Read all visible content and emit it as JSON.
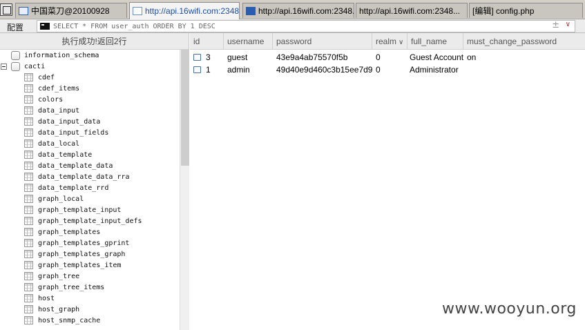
{
  "tabs": [
    {
      "label": "中国菜刀@20100928",
      "icon": "window-icon"
    },
    {
      "label": "http://api.16wifi.com:2348...",
      "icon": "page-icon",
      "active": true
    },
    {
      "label": "http://api.16wifi.com:2348...",
      "icon": "terminal-icon"
    },
    {
      "label": "http://api.16wifi.com:2348...",
      "icon": "folder-icon"
    },
    {
      "label": "[编辑] config.php",
      "icon": "edit-icon"
    }
  ],
  "query": {
    "config_label": "配置",
    "sql": "SELECT * FROM user_auth ORDER BY 1 DESC",
    "plus": "±",
    "dropdown": "∨"
  },
  "status": "执行成功!返回2行",
  "tree": {
    "databases": [
      {
        "name": "information_schema"
      },
      {
        "name": "cacti"
      }
    ],
    "tables": [
      "cdef",
      "cdef_items",
      "colors",
      "data_input",
      "data_input_data",
      "data_input_fields",
      "data_local",
      "data_template",
      "data_template_data",
      "data_template_data_rra",
      "data_template_rrd",
      "graph_local",
      "graph_template_input",
      "graph_template_input_defs",
      "graph_templates",
      "graph_templates_gprint",
      "graph_templates_graph",
      "graph_templates_item",
      "graph_tree",
      "graph_tree_items",
      "host",
      "host_graph",
      "host_snmp_cache"
    ]
  },
  "grid": {
    "columns": [
      "id",
      "username",
      "password",
      "realm",
      "full_name",
      "must_change_password"
    ],
    "rows": [
      {
        "id": "3",
        "username": "guest",
        "password": "43e9a4ab75570f5b",
        "realm": "0",
        "full_name": "Guest Account",
        "must_change_password": "on"
      },
      {
        "id": "1",
        "username": "admin",
        "password": "49d40e9d460c3b15ee7d9...",
        "realm": "0",
        "full_name": "Administrator",
        "must_change_password": ""
      }
    ]
  },
  "watermark": "www.wooyun.org"
}
